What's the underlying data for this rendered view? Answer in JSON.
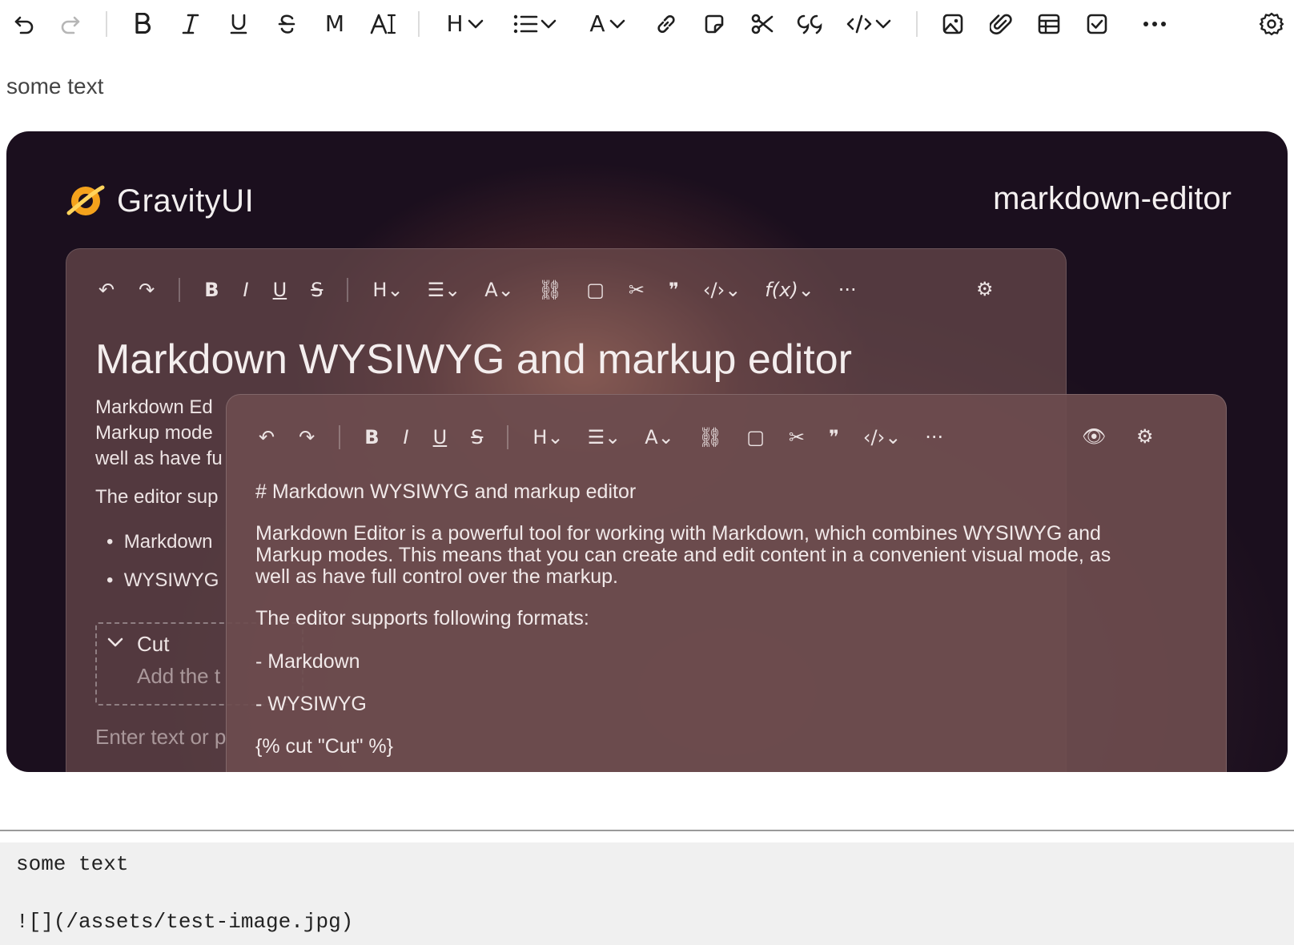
{
  "toolbar": {
    "heading_glyph": "H",
    "text_color_glyph": "A",
    "monospace_glyph": "M",
    "more_glyph": "···"
  },
  "editor": {
    "paragraph": "some text"
  },
  "image": {
    "brand": "GravityUI",
    "product": "markdown-editor",
    "back_panel": {
      "title": "Markdown WYSIWYG and markup editor",
      "lines": [
        "Markdown Ed",
        "Markup mode",
        "well as have fu",
        "The editor sup",
        "Markdown",
        "WYSIWYG"
      ],
      "cut_title": "Cut",
      "cut_placeholder": "Add the t",
      "enter_placeholder": "Enter text or p"
    },
    "front_panel": {
      "heading": "# Markdown WYSIWYG and markup editor",
      "para_line1": "Markdown Editor is a powerful tool for working with Markdown, which combines WYSIWYG and",
      "para_line2": "Markup modes. This means that you can create and edit content in a convenient visual mode, as",
      "para_line3": "well as have full control over the markup.",
      "formats": "The editor supports following formats:",
      "item1": "- Markdown",
      "item2": "- WYSIWYG",
      "cut": "{% cut \"Cut\" %}"
    }
  },
  "markup": {
    "line1": "some text",
    "line2": "![](/assets/test-image.jpg)"
  },
  "colors": {
    "toolbar_icon": "#1f1f1f",
    "disabled_icon": "#b6b6b6",
    "markup_bg": "#f0f0f0"
  }
}
